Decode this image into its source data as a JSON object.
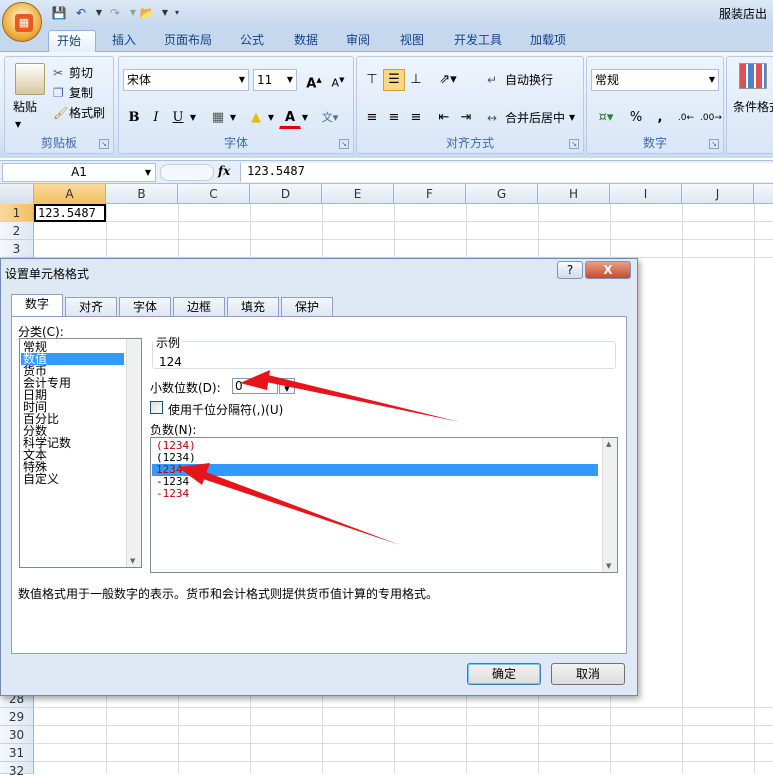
{
  "window": {
    "title": "服装店出"
  },
  "tabs": [
    "开始",
    "插入",
    "页面布局",
    "公式",
    "数据",
    "审阅",
    "视图",
    "开发工具",
    "加载项"
  ],
  "ribbon": {
    "clipboard": {
      "paste": "粘贴",
      "cut": "剪切",
      "copy": "复制",
      "format_painter": "格式刷",
      "label": "剪贴板"
    },
    "font": {
      "name": "宋体",
      "size": "11",
      "bold": "B",
      "italic": "I",
      "underline": "U",
      "label": "字体"
    },
    "alignment": {
      "wrap": "自动换行",
      "merge": "合并后居中",
      "label": "对齐方式"
    },
    "number": {
      "format": "常规",
      "percent": "%",
      "comma": ",",
      "label": "数字"
    },
    "styles": {
      "conditional": "条件格式"
    }
  },
  "formula_bar": {
    "name_box": "A1",
    "fx": "fx",
    "formula": "123.5487"
  },
  "grid": {
    "columns": [
      "A",
      "B",
      "C",
      "D",
      "E",
      "F",
      "G",
      "H",
      "I",
      "J"
    ],
    "rows_top": [
      "1",
      "2",
      "3"
    ],
    "rows_bottom": [
      "28",
      "29",
      "30",
      "31",
      "32"
    ],
    "cell_a1": "123.5487"
  },
  "dialog": {
    "title": "设置单元格格式",
    "help": "?",
    "close": "X",
    "tabs": [
      "数字",
      "对齐",
      "字体",
      "边框",
      "填充",
      "保护"
    ],
    "category_label": "分类(C):",
    "categories": [
      "常规",
      "数值",
      "货币",
      "会计专用",
      "日期",
      "时间",
      "百分比",
      "分数",
      "科学记数",
      "文本",
      "特殊",
      "自定义"
    ],
    "sample_label": "示例",
    "sample_value": "124",
    "decimal_label": "小数位数(D):",
    "decimal_value": "0",
    "separator_label": "使用千位分隔符(,)(U)",
    "negative_label": "负数(N):",
    "negatives": [
      "(1234)",
      "(1234)",
      "1234",
      "-1234",
      "-1234"
    ],
    "description": "数值格式用于一般数字的表示。货币和会计格式则提供货币值计算的专用格式。",
    "ok": "确定",
    "cancel": "取消"
  },
  "colors": {
    "selected": "#3399ff",
    "arrow": "#e8141c",
    "negative_red": "#c00000"
  }
}
